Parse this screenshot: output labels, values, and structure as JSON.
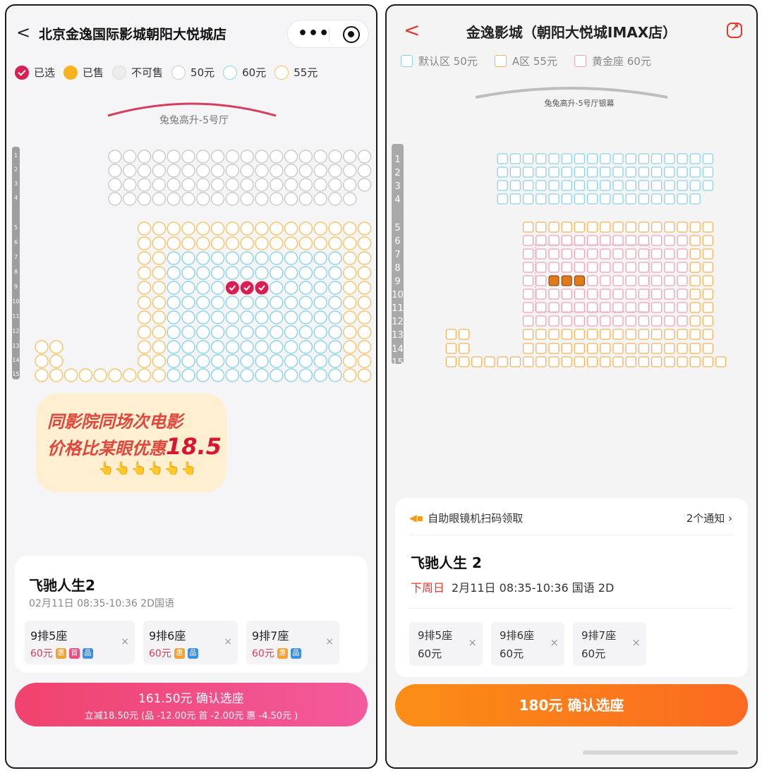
{
  "left": {
    "header": {
      "back_icon": "chevron-left-icon",
      "title": "北京金逸国际影城朝阳大悦城店",
      "more_icon": "more-dots-icon",
      "close_icon": "target-icon"
    },
    "legend": [
      {
        "key": "sel",
        "label": "已选"
      },
      {
        "key": "sold",
        "label": "已售"
      },
      {
        "key": "na",
        "label": "不可售"
      },
      {
        "key": "p50",
        "label": "50元"
      },
      {
        "key": "p60",
        "label": "60元"
      },
      {
        "key": "p55",
        "label": "55元"
      }
    ],
    "hall_name": "兔兔高升-5号厅",
    "row_numbers": [
      "1",
      "2",
      "3",
      "4",
      "5",
      "6",
      "7",
      "8",
      "9",
      "10",
      "11",
      "12",
      "13",
      "14",
      "15"
    ],
    "selected_seats": [
      {
        "row": 9,
        "col": 5
      },
      {
        "row": 9,
        "col": 6
      },
      {
        "row": 9,
        "col": 7
      }
    ],
    "promo": {
      "line1": "同影院同场次电影",
      "line2": "价格比某眼优惠",
      "amount": "18.5",
      "hands": "👆👆👆👆👆👆"
    },
    "movie": {
      "title": "飞驰人生2",
      "time": "02月11日 08:35-10:36 2D国语"
    },
    "tickets": [
      {
        "seat": "9排5座",
        "price": "60元",
        "tags": [
          "惠",
          "首",
          "品"
        ]
      },
      {
        "seat": "9排6座",
        "price": "60元",
        "tags": [
          "惠",
          "品"
        ]
      },
      {
        "seat": "9排7座",
        "price": "60元",
        "tags": [
          "惠",
          "品"
        ]
      }
    ],
    "remove_label": "×",
    "confirm": {
      "main": "161.50元 确认选座",
      "sub": "立减18.50元 (品 -12.00元 首 -2.00元 惠 -4.50元 )"
    },
    "colors": {
      "selected": "#d91f52",
      "sold": "#f9b21c",
      "price50": "#cccccc",
      "price60": "#8fd3e8",
      "price55": "#f6c56b"
    }
  },
  "right": {
    "header": {
      "back_icon": "chevron-left-icon",
      "title": "金逸影城（朝阳大悦城IMAX店）",
      "share_icon": "share-icon"
    },
    "legend": [
      {
        "key": "def",
        "label": "默认区 50元"
      },
      {
        "key": "a",
        "label": "A区 55元"
      },
      {
        "key": "gold",
        "label": "黄金座 60元"
      }
    ],
    "hall_name": "兔兔高升-5号厅银幕",
    "row_numbers": [
      "1",
      "2",
      "3",
      "4",
      "5",
      "6",
      "7",
      "8",
      "9",
      "10",
      "11",
      "12",
      "13",
      "14",
      "15"
    ],
    "notice": {
      "icon": "speaker-icon",
      "text": "自助眼镜机扫码领取",
      "count": "2个通知 ›"
    },
    "movie": {
      "title": "飞驰人生 2",
      "day": "下周日",
      "time": "2月11日  08:35-10:36  国语 2D"
    },
    "tickets": [
      {
        "seat": "9排5座",
        "price": "60元"
      },
      {
        "seat": "9排6座",
        "price": "60元"
      },
      {
        "seat": "9排7座",
        "price": "60元"
      }
    ],
    "remove_label": "×",
    "confirm": "180元 确认选座",
    "colors": {
      "default": "#8dd2e4",
      "a_zone": "#f2b45c",
      "gold": "#eea2b7"
    }
  }
}
